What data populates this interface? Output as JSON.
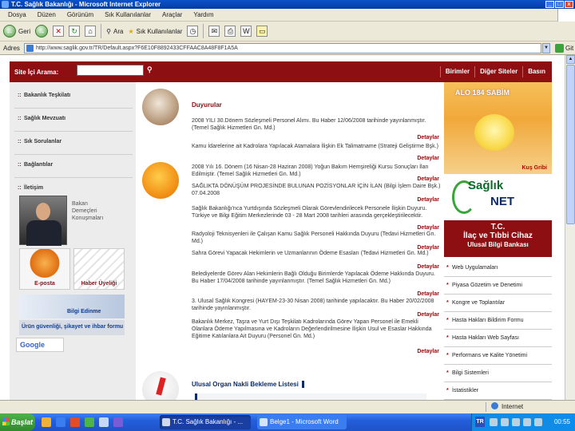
{
  "window": {
    "title": "T.C. Sağlık Bakanlığı - Microsoft Internet Explorer"
  },
  "menubar": [
    "Dosya",
    "Düzen",
    "Görünüm",
    "Sık Kullanılanlar",
    "Araçlar",
    "Yardım"
  ],
  "toolbar": {
    "back": "Geri",
    "search": "Ara",
    "favorites": "Sık Kullanılanlar"
  },
  "address": {
    "label": "Adres",
    "url": "http://www.saglik.gov.tr/TR/Default.aspx?F6E10F8892433CFFAAC8A48F8F1A5A",
    "go": "Git"
  },
  "site": {
    "search_label": "Site İçi Arama:",
    "search_icon": "magnifier",
    "top_links": [
      "Birimler",
      "Diğer Siteler",
      "Basın"
    ],
    "nav": [
      "Bakanlık Teşkilatı",
      "Sağlık Mevzuatı",
      "Sık Sorulanlar",
      "Bağlantılar",
      "İletişim"
    ],
    "minister_caption": "Bakan\nDemeçleri\nKonuşmaları",
    "tiles": {
      "eposta": "E-posta",
      "haber": "Haber Üyeliği",
      "bilgi": "Bilgi Edinme",
      "urun": "Ürün güvenliği, şikayet ve ihbar formu",
      "google": "Google"
    },
    "section_title": "Duyurular",
    "announcements": [
      "2008 YILI 30.Dönem Sözleşmeli Personel Alımı. Bu Haber 12/06/2008 tarihinde yayınlanmıştır. (Temel Sağlık Hizmetleri Gn. Md.)",
      "Kamu İdarelerine ait Kadrolara Yapılacak Atamalara İlişkin Ek Talimatname (Strateji Geliştirme Bşk.)",
      "2008 Yılı 16. Dönem (16 Nisan-28 Haziran 2008) Yoğun Bakım Hemşireliği Kursu Sonuçları İlan Edilmiştir. (Temel Sağlık Hizmetleri Gn. Md.)",
      "SAĞLIKTA DÖNÜŞÜM PROJESİNDE BULUNAN POZİSYONLAR İÇİN İLAN (Bilgi İşlem Daire Bşk.) 07.04.2008",
      "Sağlık Bakanlığı'nca Yurtdışında Sözleşmeli Olarak Görevlendirilecek Personele İlişkin Duyuru. Türkiye ve Bilgi Eğitim Merkezlerinde 03 - 28 Mart 2008 tarihleri arasında gerçekleştirilecektir.",
      "Radyoloji Teknisyenleri ile Çalışan Kamu Sağlık Personeli Hakkında Duyuru (Tedavi Hizmetleri Gn. Md.)",
      "Sahra Görevi Yapacak Hekimlerin ve Uzmanlarının Ödeme Esasları (Tedavi Hizmetleri Gn. Md.)",
      "Belediyelerde Görev Alan Hekimlerin Bağlı Olduğu Birimlerde Yapılacak Ödeme Hakkında Duyuru. Bu Haber 17/04/2008 tarihinde yayınlanmıştır. (Temel Sağlık Hizmetleri Gn. Md.)",
      "3. Ulusal Sağlık Kongresi (HAYEM-23-30 Nisan 2008) tarihinde yapılacaktır. Bu Haber 20/02/2008 tarihinde yayınlanmıştır.",
      "Bakanlık Merkez, Taşra ve Yurt Dışı Teşkilatı Kadrolarında Görev Yapan Personel ile Emekli Olanlara Ödeme Yapılmasına ve Kadroların Değerlendirilmesine İlişkin Usul ve Esaslar Hakkında Eğitime Katılanlara Ait Duyuru (Personel Gn. Md.)"
    ],
    "details_label": "Detaylar",
    "organ_title": "Ulusal Organ Nakli Bekleme Listesi",
    "right": {
      "alo": "ALO 184 SABİM",
      "kus": "Kuş Gribi",
      "saglik": "Sağlık",
      "net": "NET",
      "ilac": [
        "T.C.",
        "İlaç ve Tıbbi Cihaz",
        "Ulusal Bilgi Bankası"
      ],
      "links": [
        "Web Uygulamaları",
        "Piyasa Gözetim ve Denetimi",
        "Kongre ve Toplantılar",
        "Hasta Hakları Bildirim Formu",
        "Hasta Hakları Web Sayfası",
        "Performans ve Kalite Yönetimi",
        "Bilgi Sistemleri",
        "İstatistikler"
      ]
    }
  },
  "statusbar": {
    "zone": "Internet"
  },
  "taskbar": {
    "start": "Başlat",
    "tasks": [
      "T.C. Sağlık Bakanlığı - ...",
      "Belge1 - Microsoft Word"
    ],
    "lang": "TR",
    "clock": "00:55"
  },
  "colors": {
    "brand_red": "#8e0f12",
    "taskbar_blue": "#245edb"
  }
}
